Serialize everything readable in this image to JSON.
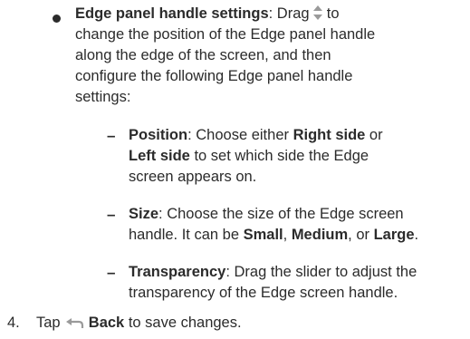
{
  "bullet_item": {
    "title": "Edge panel handle settings",
    "text_before_icon": ": Drag",
    "text_after_icon": " to",
    "line2": "change the position of the Edge panel handle",
    "line3": "along the edge of the screen, and then",
    "line4": "configure the following Edge panel handle",
    "line5": "settings:"
  },
  "sub_items": {
    "dash_glyph": "–",
    "position": {
      "title": "Position",
      "line1_a": ": Choose either ",
      "right_side": "Right side",
      "line1_b": " or",
      "left_side": "Left side",
      "line2_b": " to set which side the Edge",
      "line3": "screen appears on."
    },
    "size": {
      "title": "Size",
      "line1_a": ": Choose the size of the Edge screen",
      "line2_a": "handle. It can be ",
      "small": "Small",
      "sep1": ", ",
      "medium": "Medium",
      "sep2": ", or ",
      "large": "Large",
      "end": "."
    },
    "transparency": {
      "title": "Transparency",
      "line1_a": ": Drag the slider to adjust the",
      "line2": "transparency of the Edge screen handle."
    }
  },
  "step4": {
    "number": "4.",
    "text_a": "Tap ",
    "back": "Back",
    "text_b": " to save changes."
  },
  "icons": {
    "drag_handle": "up-down-arrows-icon",
    "back": "back-arrow-icon"
  },
  "colors": {
    "text": "#2b2b2b",
    "icon": "#9a9a9a"
  }
}
